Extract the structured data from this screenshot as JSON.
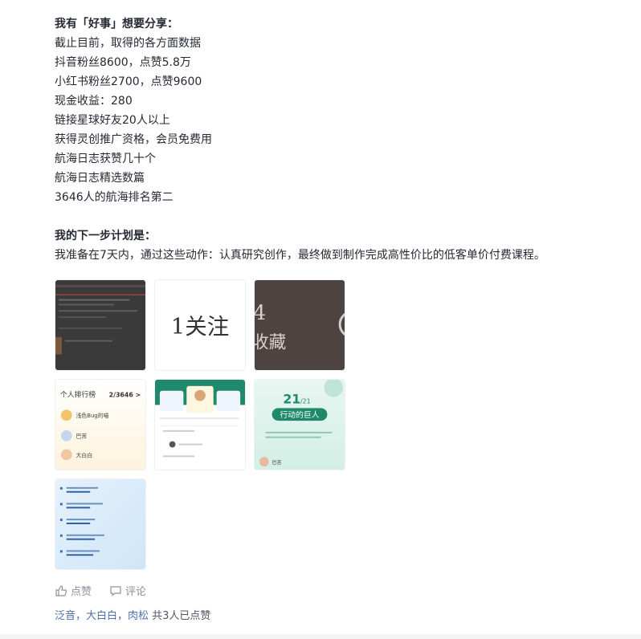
{
  "post": {
    "lines": [
      {
        "text": "我有「好事」想要分享：",
        "bold": true
      },
      {
        "text": "截止目前，取得的各方面数据"
      },
      {
        "text": "抖音粉丝8600，点赞5.8万"
      },
      {
        "text": "小红书粉丝2700，点赞9600"
      },
      {
        "text": "现金收益：280"
      },
      {
        "text": "链接星球好友20人以上"
      },
      {
        "text": "获得灵创推广资格，会员免费用"
      },
      {
        "text": "航海日志获赞几十个"
      },
      {
        "text": "航海日志精选数篇"
      },
      {
        "text": "3646人的航海排名第二"
      }
    ],
    "plan_title": "我的下一步计划是：",
    "plan_text": "我准备在7天内，通过这些动作：认真研究创作，最终做到制作完成高性价比的低客单价付费课程。"
  },
  "thumbs": {
    "t2_text": "1关注",
    "t3_num": "4",
    "t3_text": "收藏",
    "t4_title": "个人排行榜",
    "t4_rank": "2/3646 >",
    "t4_rows": [
      "浅色Bug的喵",
      "巴苦",
      "大白白"
    ],
    "t6_big": "21",
    "t6_small": "/21",
    "t6_badge": "行动的巨人",
    "t6_name": "巴苦"
  },
  "actions": {
    "like_label": "点赞",
    "comment_label": "评论"
  },
  "likes": {
    "names": "泛音，大白白，肉松",
    "count_text": " 共3人已点赞"
  },
  "colors": {
    "text": "#252933",
    "muted": "#8a919f",
    "link": "#4f6ea8",
    "green": "#1f8a6a"
  }
}
